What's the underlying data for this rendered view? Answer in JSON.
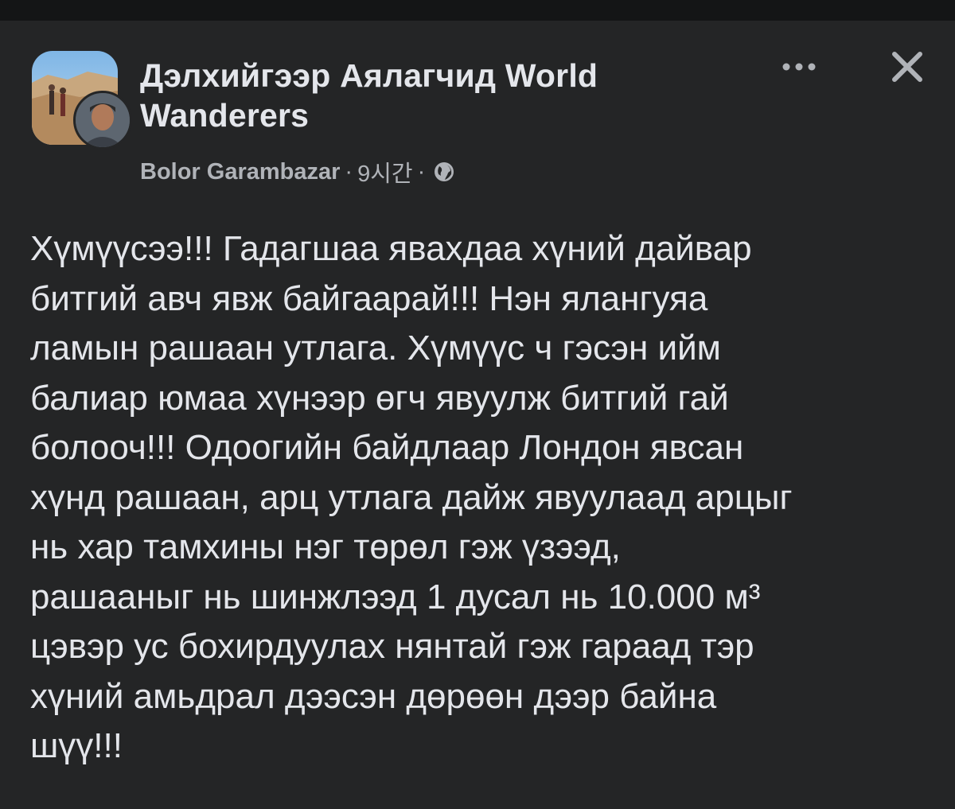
{
  "post": {
    "group_name_line1": "Дэлхийгээр Аялагчид World",
    "group_name_line2": "Wanderers",
    "author": "Bolor Garambazar",
    "time": "9시간",
    "separator": "·",
    "privacy_icon": "globe-icon",
    "more_icon": "more-horizontal-icon",
    "close_icon": "close-icon",
    "body_lines": [
      "Хүмүүсээ!!! Гадагшаа явахдаа хүний дайвар",
      "битгий  авч явж байгаарай!!! Нэн ялангуяа",
      "ламын рашаан утлага. Хүмүүс ч гэсэн ийм",
      "балиар юмаа хүнээр өгч явуулж битгий гай",
      "болооч!!! Одоогийн байдлаар Лондон явсан",
      "хүнд рашаан, арц утлага дайж явуулаад арцыг",
      "нь хар тамхины нэг төрөл гэж үзээд,",
      "рашааныг нь шинжлээд 1 дусал нь 10.000 м³",
      "цэвэр ус бохирдуулах нянтай гэж гараад тэр",
      "хүний амьдрал дээсэн дөрөөн дээр байна",
      "шүү!!!"
    ]
  },
  "colors": {
    "background": "#242526",
    "primary_text": "#e4e6eb",
    "secondary_text": "#b0b3b8"
  }
}
